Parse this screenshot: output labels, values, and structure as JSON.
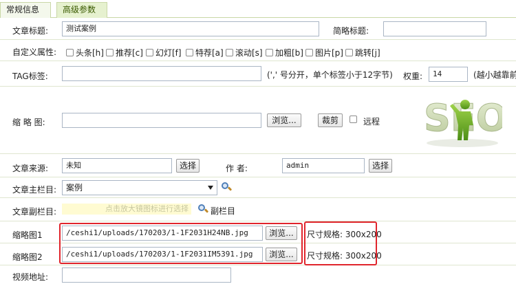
{
  "tabs": {
    "normal": "常规信息",
    "advanced": "高级参数"
  },
  "title_row": {
    "label": "文章标题:",
    "value": "测试案例",
    "short_label": "简略标题:",
    "short_value": ""
  },
  "attr_row": {
    "label": "自定义属性:",
    "items": [
      "头条[h]",
      "推荐[c]",
      "幻灯[f]",
      "特荐[a]",
      "滚动[s]",
      "加粗[b]",
      "图片[p]",
      "跳转[j]"
    ]
  },
  "tag_row": {
    "label": "TAG标签:",
    "value": "",
    "hint": "(',' 号分开，单个标签小于12字节)",
    "weight_label": "权重:",
    "weight_value": "14",
    "weight_hint": "(越小越靠前)"
  },
  "thumb_row": {
    "label": "缩 略 图:",
    "value": "",
    "browse": "浏览...",
    "crop": "裁剪",
    "remote": "远程",
    "logo_text": "SEO"
  },
  "source_row": {
    "label": "文章来源:",
    "value": "未知",
    "select_btn": "选择",
    "author_label": "作 者:",
    "author_value": "admin",
    "author_btn": "选择"
  },
  "column_row": {
    "label": "文章主栏目:",
    "selected": "案例"
  },
  "subcolumn_row": {
    "label": "文章副栏目:",
    "hint": "点击放大镜图标进行选择",
    "link": "副栏目"
  },
  "img1_row": {
    "label": "缩略图1",
    "value": "/ceshi1/uploads/170203/1-1F2031H24NB.jpg",
    "browse": "浏览...",
    "size": "尺寸规格: 300x200"
  },
  "img2_row": {
    "label": "缩略图2",
    "value": "/ceshi1/uploads/170203/1-1F2031IM5391.jpg",
    "browse": "浏览...",
    "size": "尺寸规格: 300x200"
  },
  "video_row": {
    "label": "视频地址:",
    "value": ""
  },
  "colors": {
    "accent_green": "#c9d7a6",
    "highlight_red": "#e0242b",
    "hint_bg": "#fffbd2"
  }
}
